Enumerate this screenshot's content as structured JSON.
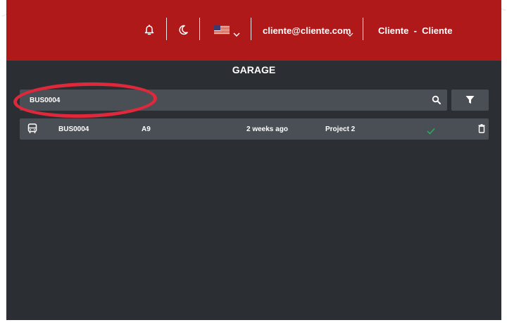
{
  "header": {
    "notification_icon": "bell-icon",
    "theme_icon": "moon-icon",
    "language_flag": "us-flag-icon",
    "user_email": "cliente@cliente.com",
    "user_name": "Cliente  -  Cliente",
    "brand_color": "#b01919"
  },
  "page": {
    "title": "GARAGE"
  },
  "search": {
    "value": "BUS0004",
    "search_icon": "search-icon",
    "filter_icon": "filter-icon"
  },
  "table": {
    "rows": [
      {
        "icon": "bus-icon",
        "code": "BUS0004",
        "line": "A9",
        "updated": "2 weeks ago",
        "project": "Project 2",
        "status_icon": "check-icon",
        "status_color": "#27ae60",
        "delete_icon": "trash-icon"
      }
    ]
  },
  "annotation": {
    "highlight_color": "#e0283b"
  }
}
